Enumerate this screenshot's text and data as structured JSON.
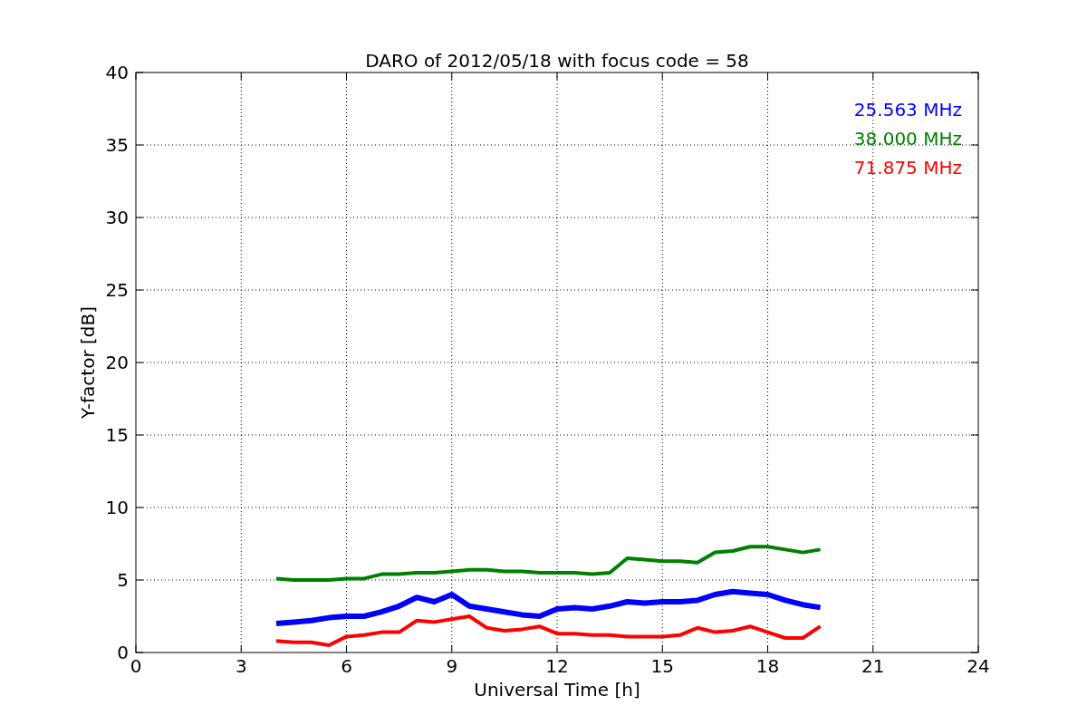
{
  "chart_data": {
    "type": "line",
    "title": "DARO of 2012/05/18 with focus code = 58",
    "xlabel": "Universal Time [h]",
    "ylabel": "Y-factor [dB]",
    "x": [
      4,
      4.5,
      5,
      5.5,
      6,
      6.5,
      7,
      7.5,
      8,
      8.5,
      9,
      9.5,
      10,
      10.5,
      11,
      11.5,
      12,
      12.5,
      13,
      13.5,
      14,
      14.5,
      15,
      15.5,
      16,
      16.5,
      17,
      17.5,
      18,
      18.5,
      19,
      19.5
    ],
    "series": [
      {
        "name": "25.563 MHz",
        "color": "#0000ff",
        "values": [
          2,
          2.1,
          2.2,
          2.4,
          2.5,
          2.5,
          2.8,
          3.2,
          3.8,
          3.5,
          4,
          3.2,
          3,
          2.8,
          2.6,
          2.5,
          3,
          3.1,
          3,
          3.2,
          3.5,
          3.4,
          3.5,
          3.5,
          3.6,
          4,
          4.2,
          4.1,
          4,
          3.6,
          3.3,
          3.1
        ]
      },
      {
        "name": "38.000 MHz",
        "color": "#008000",
        "values": [
          5.1,
          5,
          5,
          5,
          5.1,
          5.1,
          5.4,
          5.4,
          5.5,
          5.5,
          5.6,
          5.7,
          5.7,
          5.6,
          5.6,
          5.5,
          5.5,
          5.5,
          5.4,
          5.5,
          6.5,
          6.4,
          6.3,
          6.3,
          6.2,
          6.9,
          7,
          7.3,
          7.3,
          7.1,
          6.9,
          7.1
        ]
      },
      {
        "name": "71.875 MHz",
        "color": "#ff0000",
        "values": [
          0.8,
          0.7,
          0.7,
          0.5,
          1.1,
          1.2,
          1.4,
          1.4,
          2.2,
          2.1,
          2.3,
          2.5,
          1.7,
          1.5,
          1.6,
          1.8,
          1.3,
          1.3,
          1.2,
          1.2,
          1.1,
          1.1,
          1.1,
          1.2,
          1.7,
          1.4,
          1.5,
          1.8,
          1.4,
          1.0,
          1.0,
          1.8
        ]
      }
    ],
    "grid": true,
    "xlim": [
      0,
      24
    ],
    "ylim": [
      0,
      40
    ],
    "xticks": [
      0,
      3,
      6,
      9,
      12,
      15,
      18,
      21,
      24
    ],
    "yticks": [
      0,
      5,
      10,
      15,
      20,
      25,
      30,
      35,
      40
    ]
  }
}
